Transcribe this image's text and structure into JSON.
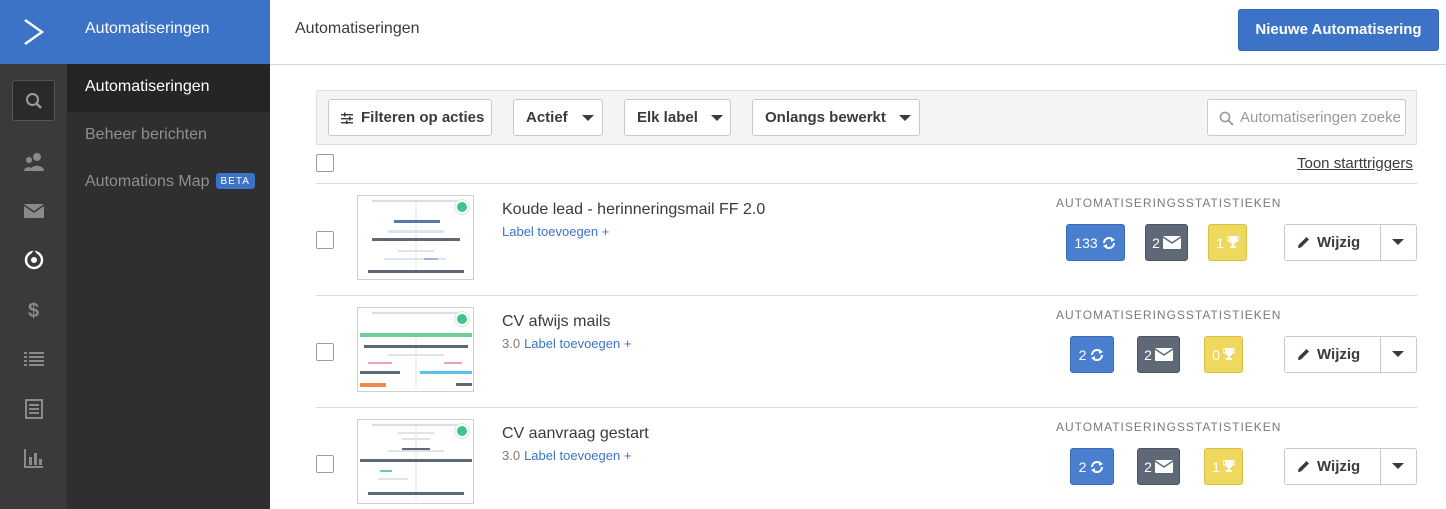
{
  "sidebar": {
    "logo_icon": "chevron-right-logo",
    "icons": [
      "search-icon",
      "contacts-icon",
      "envelope-icon",
      "automations-icon",
      "dollar-icon",
      "list-icon",
      "forms-icon",
      "reports-icon"
    ]
  },
  "submenu": {
    "header": "Automatiseringen",
    "items": [
      {
        "label": "Automatiseringen"
      },
      {
        "label": "Beheer berichten"
      },
      {
        "label": "Automations Map",
        "badge": "BETA"
      }
    ]
  },
  "topbar": {
    "title": "Automatiseringen",
    "new_button": "Nieuwe Automatisering"
  },
  "filters": {
    "filter_actions": "Filteren op acties",
    "status": "Actief",
    "label": "Elk label",
    "sort": "Onlangs bewerkt",
    "search_placeholder": "Automatiseringen zoeken"
  },
  "list": {
    "toggle_triggers": "Toon starttriggers",
    "stats_title": "AUTOMATISERINGSSTATISTIEKEN",
    "edit_label": "Wijzig",
    "rows": [
      {
        "name": "Koude lead - herinneringsmail FF 2.0",
        "version": "",
        "label_link": "Label toevoegen +",
        "contacts": "133",
        "emails": "2",
        "goals": "1"
      },
      {
        "name": "CV afwijs mails",
        "version": "3.0",
        "label_link": "Label toevoegen +",
        "contacts": "2",
        "emails": "2",
        "goals": "0"
      },
      {
        "name": "CV aanvraag gestart",
        "version": "3.0",
        "label_link": "Label toevoegen +",
        "contacts": "2",
        "emails": "2",
        "goals": "1"
      }
    ]
  },
  "colors": {
    "accent": "#3d73c7",
    "active_dot": "#3fc58a",
    "stat_blue": "#4a7fd0",
    "stat_grey": "#5f6877",
    "stat_yellow": "#efd85e"
  }
}
